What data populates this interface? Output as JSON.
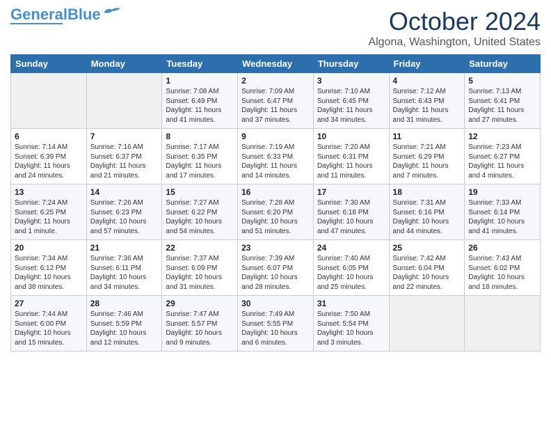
{
  "logo": {
    "line1": "General",
    "line2": "Blue"
  },
  "title": "October 2024",
  "location": "Algona, Washington, United States",
  "days_of_week": [
    "Sunday",
    "Monday",
    "Tuesday",
    "Wednesday",
    "Thursday",
    "Friday",
    "Saturday"
  ],
  "weeks": [
    [
      {
        "day": "",
        "sunrise": "",
        "sunset": "",
        "daylight": ""
      },
      {
        "day": "",
        "sunrise": "",
        "sunset": "",
        "daylight": ""
      },
      {
        "day": "1",
        "sunrise": "Sunrise: 7:08 AM",
        "sunset": "Sunset: 6:49 PM",
        "daylight": "Daylight: 11 hours and 41 minutes."
      },
      {
        "day": "2",
        "sunrise": "Sunrise: 7:09 AM",
        "sunset": "Sunset: 6:47 PM",
        "daylight": "Daylight: 11 hours and 37 minutes."
      },
      {
        "day": "3",
        "sunrise": "Sunrise: 7:10 AM",
        "sunset": "Sunset: 6:45 PM",
        "daylight": "Daylight: 11 hours and 34 minutes."
      },
      {
        "day": "4",
        "sunrise": "Sunrise: 7:12 AM",
        "sunset": "Sunset: 6:43 PM",
        "daylight": "Daylight: 11 hours and 31 minutes."
      },
      {
        "day": "5",
        "sunrise": "Sunrise: 7:13 AM",
        "sunset": "Sunset: 6:41 PM",
        "daylight": "Daylight: 11 hours and 27 minutes."
      }
    ],
    [
      {
        "day": "6",
        "sunrise": "Sunrise: 7:14 AM",
        "sunset": "Sunset: 6:39 PM",
        "daylight": "Daylight: 11 hours and 24 minutes."
      },
      {
        "day": "7",
        "sunrise": "Sunrise: 7:16 AM",
        "sunset": "Sunset: 6:37 PM",
        "daylight": "Daylight: 11 hours and 21 minutes."
      },
      {
        "day": "8",
        "sunrise": "Sunrise: 7:17 AM",
        "sunset": "Sunset: 6:35 PM",
        "daylight": "Daylight: 11 hours and 17 minutes."
      },
      {
        "day": "9",
        "sunrise": "Sunrise: 7:19 AM",
        "sunset": "Sunset: 6:33 PM",
        "daylight": "Daylight: 11 hours and 14 minutes."
      },
      {
        "day": "10",
        "sunrise": "Sunrise: 7:20 AM",
        "sunset": "Sunset: 6:31 PM",
        "daylight": "Daylight: 11 hours and 11 minutes."
      },
      {
        "day": "11",
        "sunrise": "Sunrise: 7:21 AM",
        "sunset": "Sunset: 6:29 PM",
        "daylight": "Daylight: 11 hours and 7 minutes."
      },
      {
        "day": "12",
        "sunrise": "Sunrise: 7:23 AM",
        "sunset": "Sunset: 6:27 PM",
        "daylight": "Daylight: 11 hours and 4 minutes."
      }
    ],
    [
      {
        "day": "13",
        "sunrise": "Sunrise: 7:24 AM",
        "sunset": "Sunset: 6:25 PM",
        "daylight": "Daylight: 11 hours and 1 minute."
      },
      {
        "day": "14",
        "sunrise": "Sunrise: 7:26 AM",
        "sunset": "Sunset: 6:23 PM",
        "daylight": "Daylight: 10 hours and 57 minutes."
      },
      {
        "day": "15",
        "sunrise": "Sunrise: 7:27 AM",
        "sunset": "Sunset: 6:22 PM",
        "daylight": "Daylight: 10 hours and 54 minutes."
      },
      {
        "day": "16",
        "sunrise": "Sunrise: 7:28 AM",
        "sunset": "Sunset: 6:20 PM",
        "daylight": "Daylight: 10 hours and 51 minutes."
      },
      {
        "day": "17",
        "sunrise": "Sunrise: 7:30 AM",
        "sunset": "Sunset: 6:18 PM",
        "daylight": "Daylight: 10 hours and 47 minutes."
      },
      {
        "day": "18",
        "sunrise": "Sunrise: 7:31 AM",
        "sunset": "Sunset: 6:16 PM",
        "daylight": "Daylight: 10 hours and 44 minutes."
      },
      {
        "day": "19",
        "sunrise": "Sunrise: 7:33 AM",
        "sunset": "Sunset: 6:14 PM",
        "daylight": "Daylight: 10 hours and 41 minutes."
      }
    ],
    [
      {
        "day": "20",
        "sunrise": "Sunrise: 7:34 AM",
        "sunset": "Sunset: 6:12 PM",
        "daylight": "Daylight: 10 hours and 38 minutes."
      },
      {
        "day": "21",
        "sunrise": "Sunrise: 7:36 AM",
        "sunset": "Sunset: 6:11 PM",
        "daylight": "Daylight: 10 hours and 34 minutes."
      },
      {
        "day": "22",
        "sunrise": "Sunrise: 7:37 AM",
        "sunset": "Sunset: 6:09 PM",
        "daylight": "Daylight: 10 hours and 31 minutes."
      },
      {
        "day": "23",
        "sunrise": "Sunrise: 7:39 AM",
        "sunset": "Sunset: 6:07 PM",
        "daylight": "Daylight: 10 hours and 28 minutes."
      },
      {
        "day": "24",
        "sunrise": "Sunrise: 7:40 AM",
        "sunset": "Sunset: 6:05 PM",
        "daylight": "Daylight: 10 hours and 25 minutes."
      },
      {
        "day": "25",
        "sunrise": "Sunrise: 7:42 AM",
        "sunset": "Sunset: 6:04 PM",
        "daylight": "Daylight: 10 hours and 22 minutes."
      },
      {
        "day": "26",
        "sunrise": "Sunrise: 7:43 AM",
        "sunset": "Sunset: 6:02 PM",
        "daylight": "Daylight: 10 hours and 18 minutes."
      }
    ],
    [
      {
        "day": "27",
        "sunrise": "Sunrise: 7:44 AM",
        "sunset": "Sunset: 6:00 PM",
        "daylight": "Daylight: 10 hours and 15 minutes."
      },
      {
        "day": "28",
        "sunrise": "Sunrise: 7:46 AM",
        "sunset": "Sunset: 5:59 PM",
        "daylight": "Daylight: 10 hours and 12 minutes."
      },
      {
        "day": "29",
        "sunrise": "Sunrise: 7:47 AM",
        "sunset": "Sunset: 5:57 PM",
        "daylight": "Daylight: 10 hours and 9 minutes."
      },
      {
        "day": "30",
        "sunrise": "Sunrise: 7:49 AM",
        "sunset": "Sunset: 5:55 PM",
        "daylight": "Daylight: 10 hours and 6 minutes."
      },
      {
        "day": "31",
        "sunrise": "Sunrise: 7:50 AM",
        "sunset": "Sunset: 5:54 PM",
        "daylight": "Daylight: 10 hours and 3 minutes."
      },
      {
        "day": "",
        "sunrise": "",
        "sunset": "",
        "daylight": ""
      },
      {
        "day": "",
        "sunrise": "",
        "sunset": "",
        "daylight": ""
      }
    ]
  ]
}
